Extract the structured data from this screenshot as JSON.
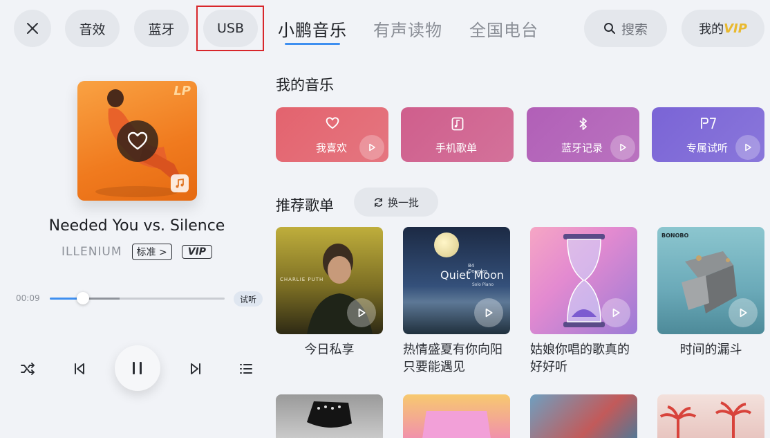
{
  "topbar": {
    "close_icon": "close-icon",
    "buttons": [
      "音效",
      "蓝牙",
      "USB"
    ],
    "tabs": [
      "小鹏音乐",
      "有声读物",
      "全国电台"
    ],
    "search_label": "搜索",
    "vip_prefix": "我的",
    "vip_suffix": "VIP"
  },
  "player": {
    "cover_corner_text": "LP",
    "title": "Needed You vs. Silence",
    "artist": "ILLENIUM",
    "quality_tag": "标准 >",
    "vip_tag": "VIP",
    "current_time": "00:09",
    "progress": 0.19,
    "buffered": 0.4,
    "preview_badge": "试听",
    "controls": [
      "shuffle-icon",
      "previous-icon",
      "pause-icon",
      "next-icon",
      "playlist-icon"
    ]
  },
  "my_music": {
    "title": "我的音乐",
    "cards": [
      {
        "label": "我喜欢",
        "icon": "heart-icon",
        "color": "#e3636e"
      },
      {
        "label": "手机歌单",
        "icon": "music-note-icon",
        "color": "#cf5e8c"
      },
      {
        "label": "蓝牙记录",
        "icon": "bluetooth-icon",
        "color": "#b15fb7"
      },
      {
        "label": "专属试听",
        "icon": "p7-icon",
        "color": "#7a64d6"
      }
    ]
  },
  "recommended": {
    "title": "推荐歌单",
    "refresh_label": "换一批",
    "playlists": [
      {
        "caption": "今日私享",
        "art_text": "CHARLIE PUTH"
      },
      {
        "caption": "热情盛夏有你向阳只要能遇见",
        "art_text": "Quiet Moon",
        "art_sub": "Solo Piano",
        "art_top": "B4 Douglas"
      },
      {
        "caption": "姑娘你唱的歌真的好好听"
      },
      {
        "caption": "时间的漏斗",
        "art_text": "BONOBO"
      }
    ]
  }
}
